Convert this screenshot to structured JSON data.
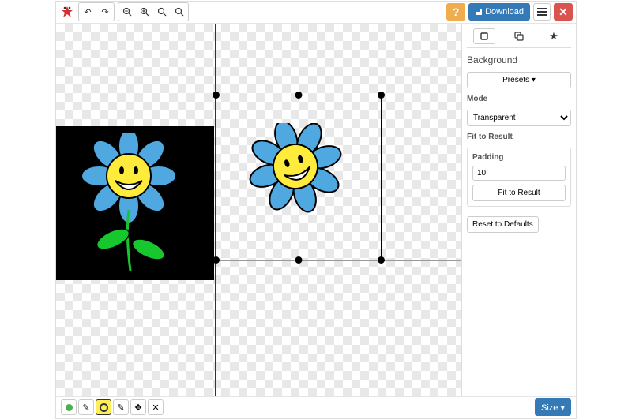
{
  "header": {
    "download_label": "Download"
  },
  "sidebar": {
    "section_title": "Background",
    "presets_label": "Presets",
    "mode_label": "Mode",
    "mode_value": "Transparent",
    "fit_title": "Fit to Result",
    "padding_label": "Padding",
    "padding_value": "10",
    "fit_button": "Fit to Result",
    "reset_button": "Reset to Defaults"
  },
  "footer": {
    "size_label": "Size"
  }
}
